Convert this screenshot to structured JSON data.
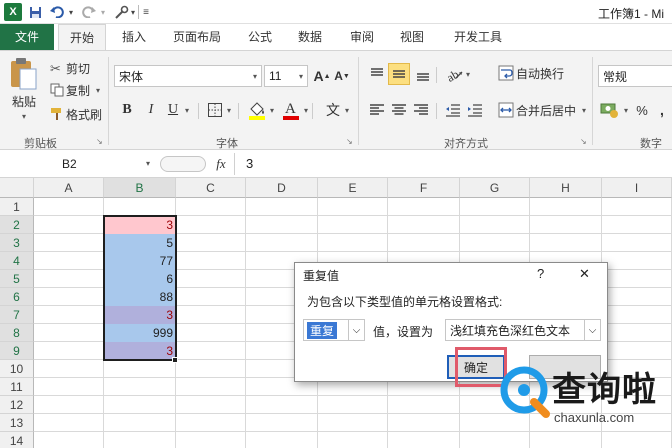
{
  "titlebar": {
    "doc_title": "工作簿1 - Mi"
  },
  "tabs": [
    "文件",
    "开始",
    "插入",
    "页面布局",
    "公式",
    "数据",
    "审阅",
    "视图",
    "开发工具"
  ],
  "ribbon": {
    "clipboard": {
      "paste": "粘贴",
      "cut": "剪切",
      "copy": "复制",
      "format_painter": "格式刷",
      "label": "剪贴板"
    },
    "font": {
      "font_name": "宋体",
      "font_size": "11",
      "bold": "B",
      "italic": "I",
      "underline": "U",
      "label": "字体",
      "wen": "文"
    },
    "alignment": {
      "wrap_text": "自动换行",
      "merge_center": "合并后居中",
      "label": "对齐方式"
    },
    "number": {
      "format": "常规",
      "percent": "%",
      "label": "数字"
    }
  },
  "formula_bar": {
    "name_box": "B2",
    "fx": "fx",
    "value": "3"
  },
  "grid": {
    "columns": [
      "A",
      "B",
      "C",
      "D",
      "E",
      "F",
      "G",
      "H",
      "I"
    ],
    "rows": [
      "1",
      "2",
      "3",
      "4",
      "5",
      "6",
      "7",
      "8",
      "9",
      "10",
      "11",
      "12",
      "13",
      "14"
    ],
    "b_values": [
      "3",
      "5",
      "77",
      "6",
      "88",
      "3",
      "999",
      "3"
    ]
  },
  "colors": {
    "excel_green": "#217346",
    "blue_fill": "#a8c8ec",
    "pink_fill": "#ffc7ce",
    "dup_text": "#9c0006",
    "purple_fill": "#b0b0dc"
  },
  "dialog": {
    "title": "重复值",
    "help": "?",
    "close": "✕",
    "prompt": "为包含以下类型值的单元格设置格式:",
    "type_value": "重复",
    "mid_label": "值，设置为",
    "format_value": "浅红填充色深红色文本",
    "ok": "确定"
  },
  "watermark": {
    "cn": "查询啦",
    "url": "chaxunla.com"
  }
}
